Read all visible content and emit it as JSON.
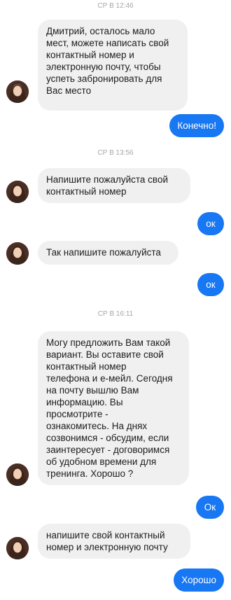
{
  "timestamps": [
    "СР В 12:46",
    "СР В 13:56",
    "СР В 16:11"
  ],
  "messages": {
    "m1": "Дмитрий, осталось мало\nмест, можете написать свой\nконтактный номер и\nэлектронную почту, чтобы\nуспеть забронировать для\nВас место",
    "r1": "Конечно!",
    "m2": "Напишите пожалуйста свой\nконтактный номер",
    "r2": "ок",
    "m3": "Так напишите пожалуйста",
    "r3": "ок",
    "m4": "Могу предложить Вам такой\nвариант. Вы оставите свой\nконтактный номер\nтелефона и е-мейл. Сегодня\nна почту вышлю Вам\nинформацию. Вы\nпросмотрите -\nознакомитесь. На днях\nсозвонимся - обсудим, если\nзаинтересует - договоримся\nоб удобном времени для\nтренинга. Хорошо ?",
    "r4": "Ок",
    "m5": "напишите свой контактный\nномер и электронную почту",
    "r5": "Хорошо"
  },
  "colors": {
    "incoming_bubble": "#f1f0f0",
    "outgoing_bubble": "#1877f2",
    "timestamp": "#a7a7a7"
  },
  "icons": {
    "avatar": "contact-avatar-photo"
  }
}
